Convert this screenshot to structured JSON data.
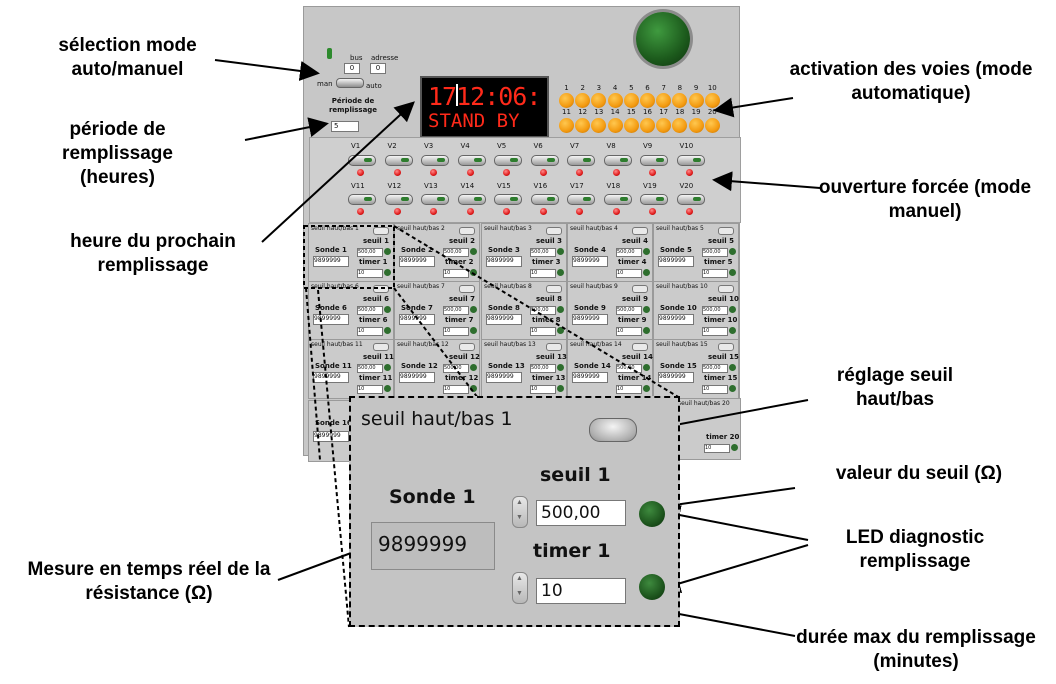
{
  "callouts": {
    "mode": "sélection mode auto/manuel",
    "periode": "période de remplissage (heures)",
    "heure": "heure du prochain remplissage",
    "activation": "activation des voies (mode automatique)",
    "ouverture": "ouverture forcée (mode manuel)",
    "reglage": "réglage seuil haut/bas",
    "valeur": "valeur du seuil (Ω)",
    "led": "LED diagnostic remplissage",
    "mesure": "Mesure en temps réel de la résistance (Ω)",
    "duree": "durée max du remplissage (minutes)"
  },
  "panel": {
    "bus_label": "bus",
    "adresse_label": "adresse",
    "bus_value": "0",
    "adresse_value": "0",
    "manuel_label": "man",
    "auto_label": "auto",
    "periode_label": "Période de remplissage",
    "periode_value": "5",
    "display_time": "1712:06:",
    "display_status": "STAND BY",
    "channel_numbers_row1": [
      "1",
      "2",
      "3",
      "4",
      "5",
      "6",
      "7",
      "8",
      "9",
      "10"
    ],
    "channel_numbers_row2": [
      "11",
      "12",
      "13",
      "14",
      "15",
      "16",
      "17",
      "18",
      "19",
      "20"
    ],
    "valves_row1": [
      "V1",
      "V2",
      "V3",
      "V4",
      "V5",
      "V6",
      "V7",
      "V8",
      "V9",
      "V10"
    ],
    "valves_row2": [
      "V11",
      "V12",
      "V13",
      "V14",
      "V15",
      "V16",
      "V17",
      "V18",
      "V19",
      "V20"
    ]
  },
  "sondes": [
    {
      "title": "seuil haut/bas 1",
      "sonde": "Sonde 1",
      "value": "9899999",
      "seuil": "seuil 1",
      "timer": "timer 1",
      "seuil_val": "500,00",
      "timer_val": "10"
    },
    {
      "title": "seuil haut/bas 2",
      "sonde": "Sonde 2",
      "value": "9899999",
      "seuil": "seuil 2",
      "timer": "timer 2",
      "seuil_val": "500,00",
      "timer_val": "10"
    },
    {
      "title": "seuil haut/bas 3",
      "sonde": "Sonde 3",
      "value": "9899999",
      "seuil": "seuil 3",
      "timer": "timer 3",
      "seuil_val": "500,00",
      "timer_val": "10"
    },
    {
      "title": "seuil haut/bas 4",
      "sonde": "Sonde 4",
      "value": "9899999",
      "seuil": "seuil 4",
      "timer": "timer 4",
      "seuil_val": "500,00",
      "timer_val": "10"
    },
    {
      "title": "seuil haut/bas 5",
      "sonde": "Sonde 5",
      "value": "9899999",
      "seuil": "seuil 5",
      "timer": "timer 5",
      "seuil_val": "500,00",
      "timer_val": "10"
    },
    {
      "title": "seuil haut/bas 6",
      "sonde": "Sonde 6",
      "value": "9899999",
      "seuil": "seuil 6",
      "timer": "timer 6",
      "seuil_val": "500,00",
      "timer_val": "10"
    },
    {
      "title": "seuil haut/bas 7",
      "sonde": "Sonde 7",
      "value": "9899999",
      "seuil": "seuil 7",
      "timer": "timer 7",
      "seuil_val": "500,00",
      "timer_val": "10"
    },
    {
      "title": "seuil haut/bas 8",
      "sonde": "Sonde 8",
      "value": "9899999",
      "seuil": "seuil 8",
      "timer": "timer 8",
      "seuil_val": "500,00",
      "timer_val": "10"
    },
    {
      "title": "seuil haut/bas 9",
      "sonde": "Sonde 9",
      "value": "9899999",
      "seuil": "seuil 9",
      "timer": "timer 9",
      "seuil_val": "500,00",
      "timer_val": "10"
    },
    {
      "title": "seuil haut/bas 10",
      "sonde": "Sonde 10",
      "value": "9899999",
      "seuil": "seuil 10",
      "timer": "timer 10",
      "seuil_val": "500,00",
      "timer_val": "10"
    },
    {
      "title": "seuil haut/bas 11",
      "sonde": "Sonde 11",
      "value": "9899999",
      "seuil": "seuil 11",
      "timer": "timer 11",
      "seuil_val": "500,00",
      "timer_val": "10"
    },
    {
      "title": "seuil haut/bas 12",
      "sonde": "Sonde 12",
      "value": "9899999",
      "seuil": "seuil 12",
      "timer": "timer 12",
      "seuil_val": "500,00",
      "timer_val": "10"
    },
    {
      "title": "seuil haut/bas 13",
      "sonde": "Sonde 13",
      "value": "9899999",
      "seuil": "seuil 13",
      "timer": "timer 13",
      "seuil_val": "500,00",
      "timer_val": "10"
    },
    {
      "title": "seuil haut/bas 14",
      "sonde": "Sonde 14",
      "value": "9899999",
      "seuil": "seuil 14",
      "timer": "timer 14",
      "seuil_val": "500,00",
      "timer_val": "10"
    },
    {
      "title": "seuil haut/bas 15",
      "sonde": "Sonde 15",
      "value": "9899999",
      "seuil": "seuil 15",
      "timer": "timer 15",
      "seuil_val": "500,00",
      "timer_val": "10"
    }
  ],
  "sonde16": {
    "sonde": "Sonde 16",
    "value": "9899999"
  },
  "sonde20": {
    "title": "seuil haut/bas 20",
    "timer": "timer 20",
    "timer_val": "10"
  },
  "zoom": {
    "title": "seuil haut/bas 1",
    "sonde": "Sonde 1",
    "value": "9899999",
    "seuil_label": "seuil 1",
    "seuil_value": "500,00",
    "timer_label": "timer 1",
    "timer_value": "10"
  },
  "colors": {
    "led_orange": "#f39a10",
    "led_red": "#e01a1a",
    "led_green": "#2e6e2e",
    "display_text": "#ff2a1a"
  }
}
